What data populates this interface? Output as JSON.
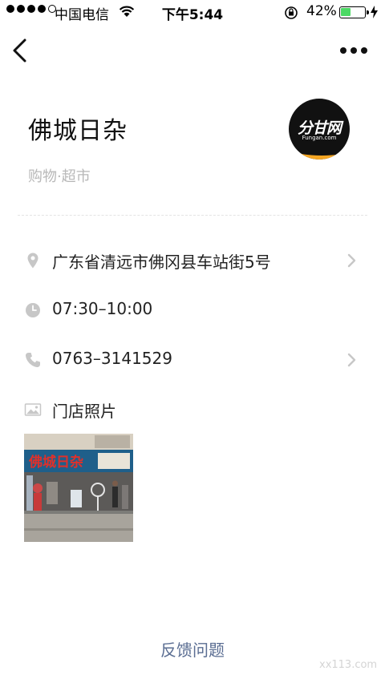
{
  "status_bar": {
    "carrier": "中国电信",
    "time": "下午5:44",
    "battery_percent": "42%",
    "battery_level": 0.42
  },
  "nav": {
    "back_icon": "chevron-left-icon",
    "more_icon": "ellipsis-icon"
  },
  "store": {
    "name": "佛城日杂",
    "category": "购物·超市",
    "logo_text": "分甘网",
    "logo_subtext": "Fungan.com"
  },
  "details": {
    "address": "广东省清远市佛冈县车站街5号",
    "hours": "07:30–10:00",
    "phone": "0763–3141529",
    "photos_label": "门店照片"
  },
  "photo": {
    "sign_text": "佛城日杂"
  },
  "footer": {
    "feedback": "反馈问题",
    "watermark": "xx113.com"
  },
  "colors": {
    "icon_gray": "#c7c7c7",
    "feedback_link": "#5a6d92",
    "battery_green": "#4cd964",
    "logo_orange": "#f5a623"
  }
}
